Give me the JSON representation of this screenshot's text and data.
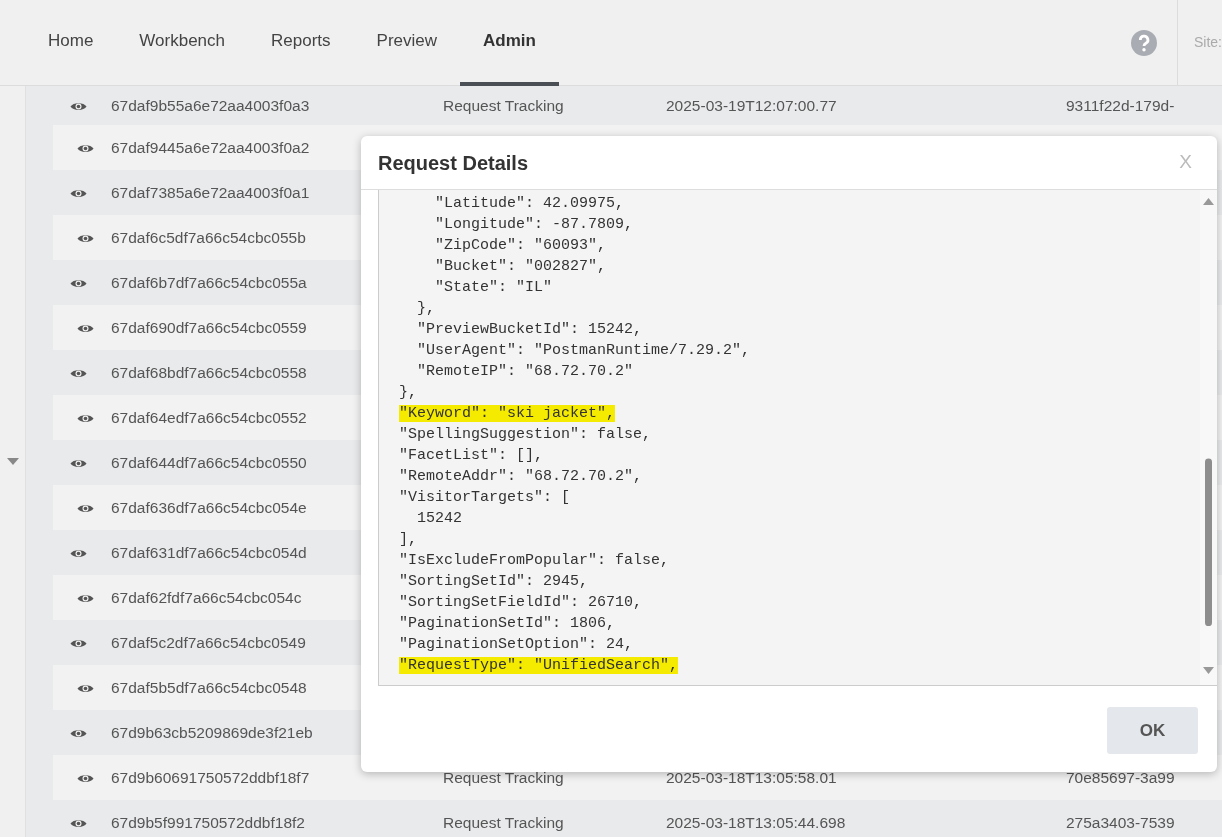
{
  "nav": {
    "tabs": [
      {
        "label": "Home",
        "selected": false
      },
      {
        "label": "Workbench",
        "selected": false
      },
      {
        "label": "Reports",
        "selected": false
      },
      {
        "label": "Preview",
        "selected": false
      },
      {
        "label": "Admin",
        "selected": true
      }
    ],
    "site_label": "Site:"
  },
  "table": {
    "rows": [
      {
        "id": "67daf9b55a6e72aa4003f0a3",
        "type": "Request Tracking",
        "timestamp": "2025-03-19T12:07:00.77",
        "guid": "9311f22d-179d-"
      },
      {
        "id": "67daf9445a6e72aa4003f0a2"
      },
      {
        "id": "67daf7385a6e72aa4003f0a1"
      },
      {
        "id": "67daf6c5df7a66c54cbc055b"
      },
      {
        "id": "67daf6b7df7a66c54cbc055a"
      },
      {
        "id": "67daf690df7a66c54cbc0559"
      },
      {
        "id": "67daf68bdf7a66c54cbc0558"
      },
      {
        "id": "67daf64edf7a66c54cbc0552"
      },
      {
        "id": "67daf644df7a66c54cbc0550"
      },
      {
        "id": "67daf636df7a66c54cbc054e"
      },
      {
        "id": "67daf631df7a66c54cbc054d"
      },
      {
        "id": "67daf62fdf7a66c54cbc054c"
      },
      {
        "id": "67daf5c2df7a66c54cbc0549"
      },
      {
        "id": "67daf5b5df7a66c54cbc0548"
      },
      {
        "id": "67d9b63cb5209869de3f21eb"
      },
      {
        "id": "67d9b60691750572ddbf18f7",
        "type": "Request Tracking",
        "timestamp": "2025-03-18T13:05:58.01",
        "guid": "70e85697-3a99"
      },
      {
        "id": "67d9b5f991750572ddbf18f2",
        "type": "Request Tracking",
        "timestamp": "2025-03-18T13:05:44.698",
        "guid": "275a3403-7539"
      }
    ]
  },
  "dialog": {
    "title": "Request Details",
    "close": "X",
    "lines": [
      {
        "text": "      \"Latitude\": 42.09975,",
        "highlighted": false
      },
      {
        "text": "      \"Longitude\": -87.7809,",
        "highlighted": false
      },
      {
        "text": "      \"ZipCode\": \"60093\",",
        "highlighted": false
      },
      {
        "text": "      \"Bucket\": \"002827\",",
        "highlighted": false
      },
      {
        "text": "      \"State\": \"IL\"",
        "highlighted": false
      },
      {
        "text": "    },",
        "highlighted": false
      },
      {
        "text": "    \"PreviewBucketId\": 15242,",
        "highlighted": false
      },
      {
        "text": "    \"UserAgent\": \"PostmanRuntime/7.29.2\",",
        "highlighted": false
      },
      {
        "text": "    \"RemoteIP\": \"68.72.70.2\"",
        "highlighted": false
      },
      {
        "text": "  },",
        "highlighted": false
      },
      {
        "text": "  \"Keyword\": \"ski jacket\",",
        "highlighted": true
      },
      {
        "text": "  \"SpellingSuggestion\": false,",
        "highlighted": false
      },
      {
        "text": "  \"FacetList\": [],",
        "highlighted": false
      },
      {
        "text": "  \"RemoteAddr\": \"68.72.70.2\",",
        "highlighted": false
      },
      {
        "text": "  \"VisitorTargets\": [",
        "highlighted": false
      },
      {
        "text": "    15242",
        "highlighted": false
      },
      {
        "text": "  ],",
        "highlighted": false
      },
      {
        "text": "  \"IsExcludeFromPopular\": false,",
        "highlighted": false
      },
      {
        "text": "  \"SortingSetId\": 2945,",
        "highlighted": false
      },
      {
        "text": "  \"SortingSetFieldId\": 26710,",
        "highlighted": false
      },
      {
        "text": "  \"PaginationSetId\": 1806,",
        "highlighted": false
      },
      {
        "text": "  \"PaginationSetOption\": 24,",
        "highlighted": false
      },
      {
        "text": "  \"RequestType\": \"UnifiedSearch\",",
        "highlighted": true
      }
    ],
    "ok": "OK"
  }
}
